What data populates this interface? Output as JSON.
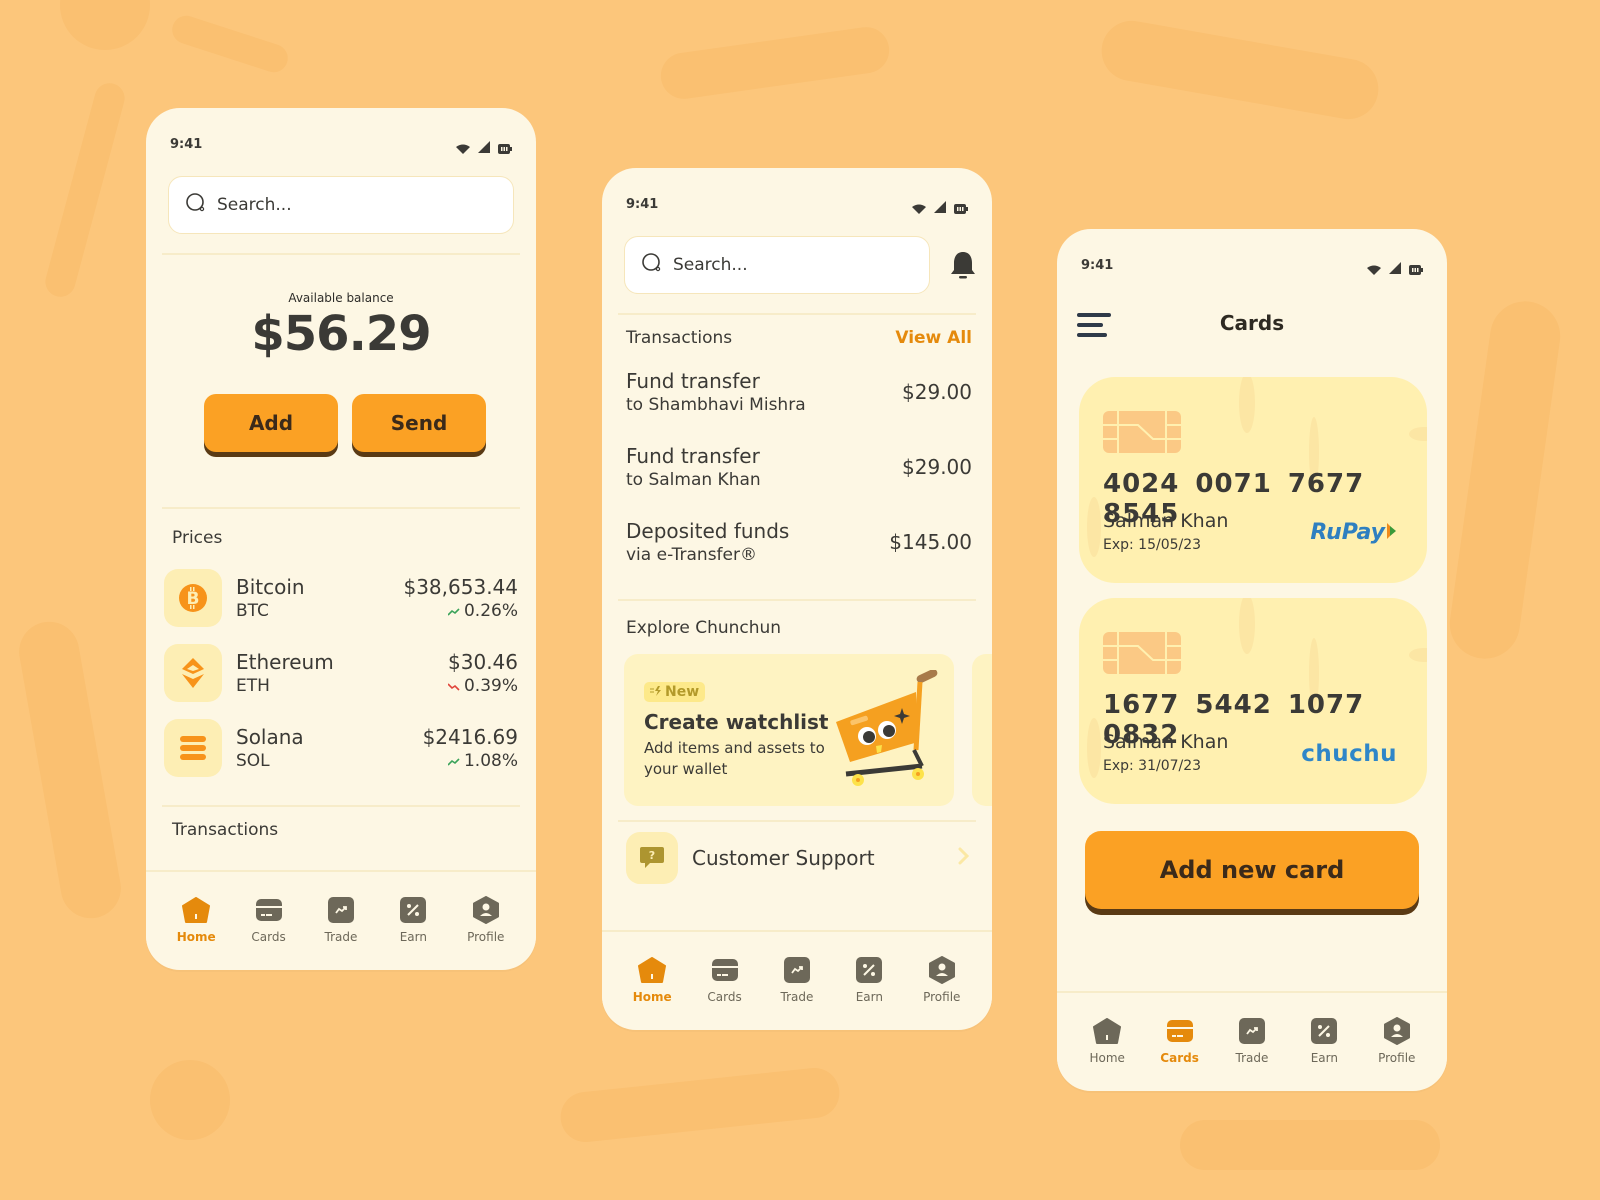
{
  "colors": {
    "background": "#fcc67b",
    "phone_bg": "#fdf7e4",
    "accent": "#fba124",
    "active_nav": "#e58a0c",
    "icon_gray": "#6d6859",
    "positive": "#3aa35a",
    "negative": "#e0443a",
    "brand_blue": "#2f7fc0"
  },
  "status_bar": {
    "time": "9:41",
    "icons": [
      "wifi-icon",
      "signal-icon",
      "battery-icon"
    ]
  },
  "nav": {
    "items": [
      {
        "label": "Home",
        "icon": "home-icon"
      },
      {
        "label": "Cards",
        "icon": "card-icon"
      },
      {
        "label": "Trade",
        "icon": "trend-icon"
      },
      {
        "label": "Earn",
        "icon": "percent-icon"
      },
      {
        "label": "Profile",
        "icon": "user-icon"
      }
    ]
  },
  "home_screen": {
    "search_placeholder": "Search...",
    "balance_label": "Available balance",
    "balance": "$56.29",
    "add_label": "Add",
    "send_label": "Send",
    "prices_title": "Prices",
    "coins": [
      {
        "name": "Bitcoin",
        "symbol": "BTC",
        "price": "$38,653.44",
        "change": "0.26%",
        "direction": "up",
        "icon": "bitcoin-icon"
      },
      {
        "name": "Ethereum",
        "symbol": "ETH",
        "price": "$30.46",
        "change": "0.39%",
        "direction": "down",
        "icon": "ethereum-icon"
      },
      {
        "name": "Solana",
        "symbol": "SOL",
        "price": "$2416.69",
        "change": "1.08%",
        "direction": "up",
        "icon": "solana-icon"
      }
    ],
    "transactions_title": "Transactions",
    "active_nav": "Home"
  },
  "transactions_screen": {
    "search_placeholder": "Search...",
    "transactions_title": "Transactions",
    "view_all": "View All",
    "transactions": [
      {
        "title": "Fund transfer",
        "subtitle": "to Shambhavi Mishra",
        "amount": "$29.00"
      },
      {
        "title": "Fund transfer",
        "subtitle": "to Salman Khan",
        "amount": "$29.00"
      },
      {
        "title": "Deposited funds",
        "subtitle": "via e-Transfer®",
        "amount": "$145.00"
      }
    ],
    "explore_title": "Explore Chunchun",
    "promo": {
      "badge": "New",
      "title": "Create watchlist",
      "description": "Add items and assets to your wallet"
    },
    "support_label": "Customer Support",
    "active_nav": "Home"
  },
  "cards_screen": {
    "title": "Cards",
    "cards": [
      {
        "number": "4024 0071 7677 8545",
        "holder": "Salman Khan",
        "expiry": "Exp: 15/05/23",
        "brand": "RuPay"
      },
      {
        "number": "1677 5442 1077 0832",
        "holder": "Salman Khan",
        "expiry": "Exp: 31/07/23",
        "brand": "chuchu"
      }
    ],
    "add_card_label": "Add new card",
    "active_nav": "Cards"
  }
}
